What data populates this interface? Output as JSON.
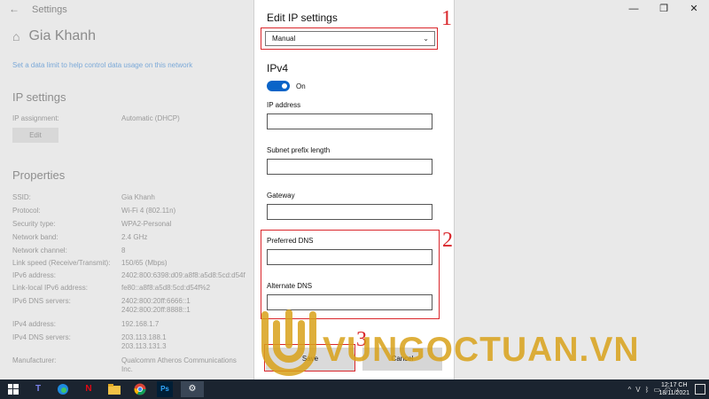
{
  "window": {
    "title": "Settings",
    "back_icon": "back-arrow-icon",
    "controls": [
      "—",
      "❐",
      "✕"
    ]
  },
  "page": {
    "home_icon": "home-icon",
    "network_name": "Gia Khanh",
    "data_limit_link": "Set a data limit to help control data usage on this network"
  },
  "ip_settings": {
    "title": "IP settings",
    "assignment_label": "IP assignment:",
    "assignment_value": "Automatic (DHCP)",
    "edit_label": "Edit"
  },
  "properties": {
    "title": "Properties",
    "rows": [
      {
        "k": "SSID:",
        "v": "Gia Khanh"
      },
      {
        "k": "Protocol:",
        "v": "Wi-Fi 4 (802.11n)"
      },
      {
        "k": "Security type:",
        "v": "WPA2-Personal"
      },
      {
        "k": "Network band:",
        "v": "2.4 GHz"
      },
      {
        "k": "Network channel:",
        "v": "8"
      },
      {
        "k": "Link speed (Receive/Transmit):",
        "v": "150/65 (Mbps)"
      },
      {
        "k": "IPv6 address:",
        "v": "2402:800:6398:d09:a8f8:a5d8:5cd:d54f"
      },
      {
        "k": "Link-local IPv6 address:",
        "v": "fe80::a8f8:a5d8:5cd:d54f%2"
      },
      {
        "k": "IPv6 DNS servers:",
        "v": "2402:800:20ff:6666::1",
        "v2": "2402:800:20ff:8888::1"
      },
      {
        "k": "IPv4 address:",
        "v": "192.168.1.7"
      },
      {
        "k": "IPv4 DNS servers:",
        "v": "203.113.188.1",
        "v2": "203.113.131.3"
      },
      {
        "k": "Manufacturer:",
        "v": "Qualcomm Atheros Communications",
        "v2": "Inc."
      }
    ]
  },
  "dialog": {
    "title": "Edit IP settings",
    "mode_value": "Manual",
    "ipv4_title": "IPv4",
    "toggle_state": "On",
    "fields": {
      "ip_address": "IP address",
      "subnet": "Subnet prefix length",
      "gateway": "Gateway",
      "preferred_dns": "Preferred DNS",
      "alternate_dns": "Alternate DNS"
    },
    "save_label": "Save",
    "cancel_label": "Cancel"
  },
  "annotations": {
    "n1": "1",
    "n2": "2",
    "n3": "3",
    "color": "#d9262b"
  },
  "watermark": {
    "text": "VUNGOCTUAN.VN",
    "color": "#d9a21a"
  },
  "taskbar": {
    "items": [
      "windows-icon",
      "teams-icon",
      "edge-icon",
      "netflix-icon",
      "file-explorer-icon",
      "chrome-icon",
      "photoshop-icon",
      "settings-icon"
    ],
    "tray_chevron": "^",
    "lang": "V",
    "time": "12:17 CH",
    "date": "18/11/2021"
  }
}
